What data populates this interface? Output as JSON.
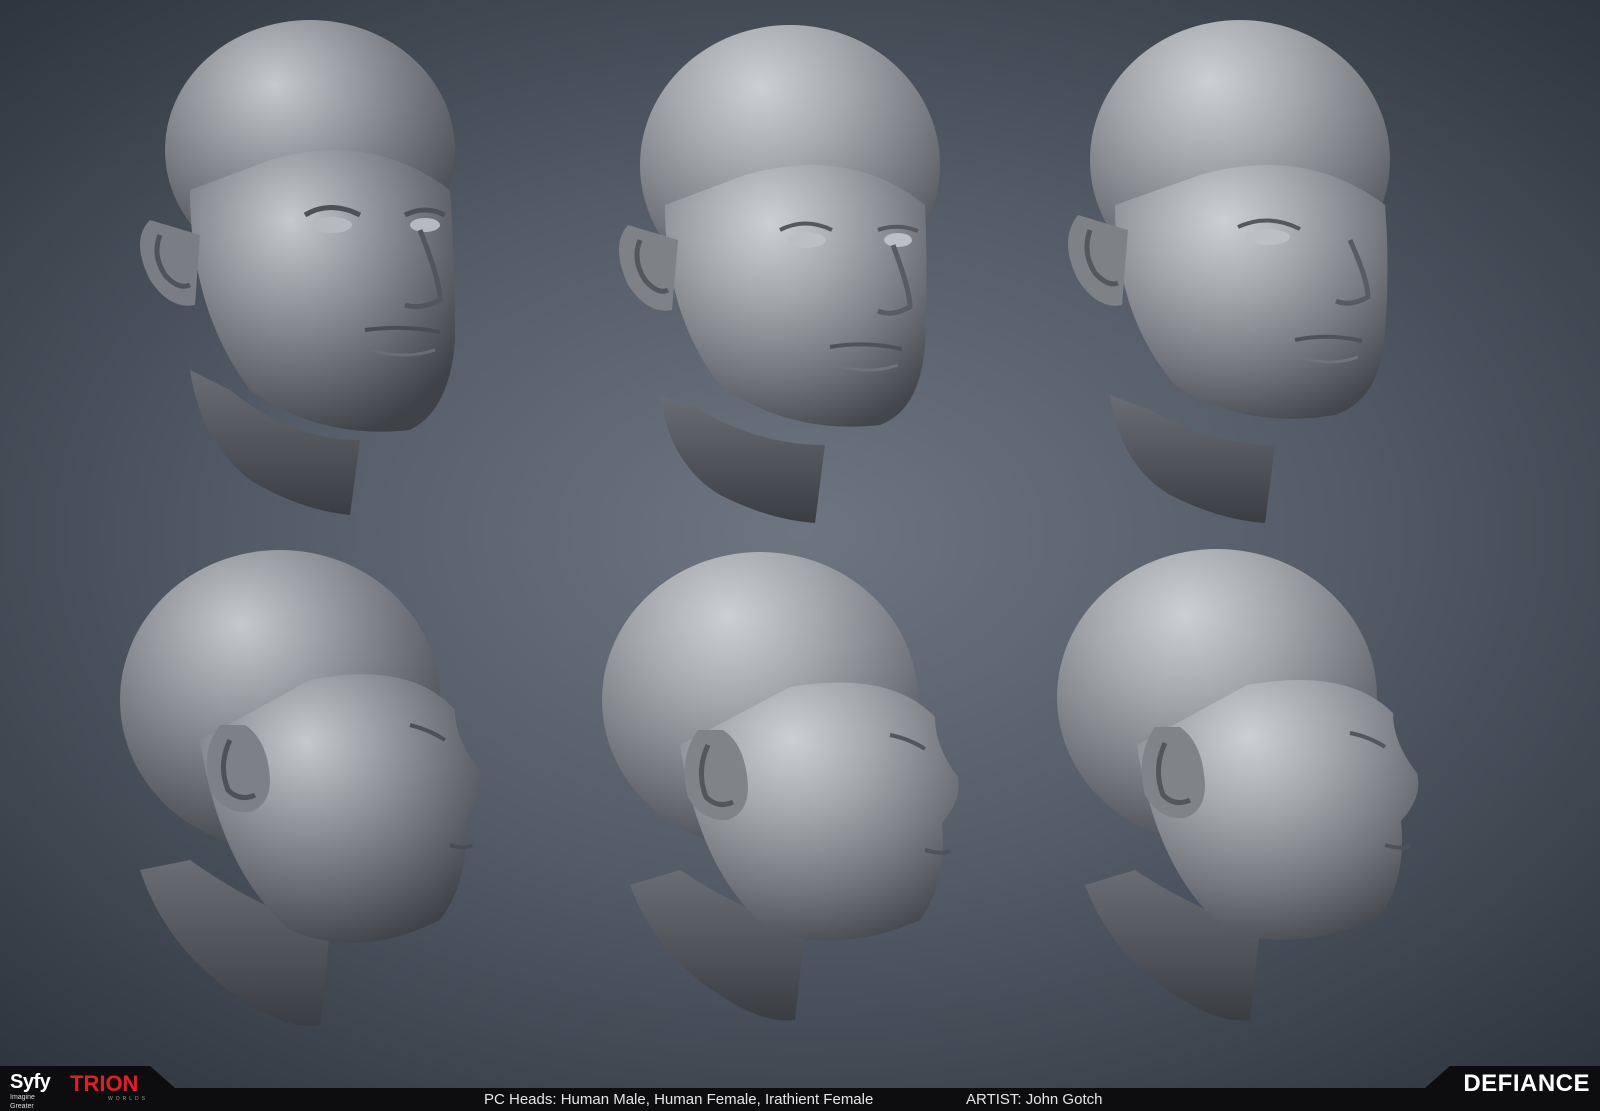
{
  "image": {
    "subject": "digital sculpt presentation of three bald head models",
    "background_color": "#5a636e",
    "sculpt_color": "#8c9096"
  },
  "views": {
    "top_row": "three-quarter front",
    "bottom_row": "side profile"
  },
  "heads": [
    {
      "model": "human-male",
      "view": "three-quarter"
    },
    {
      "model": "human-female",
      "view": "three-quarter"
    },
    {
      "model": "irathient-female",
      "view": "three-quarter"
    },
    {
      "model": "human-male",
      "view": "profile"
    },
    {
      "model": "human-female",
      "view": "profile"
    },
    {
      "model": "irathient-female",
      "view": "profile"
    }
  ],
  "footer": {
    "caption": "PC Heads: Human Male, Human Female, Irathient Female",
    "artist": "ARTIST: John Gotch",
    "bar_color": "#0d0d0f",
    "text_color": "#e6e6e6"
  },
  "logos": {
    "syfy": {
      "word": "Syfy",
      "tagline": "Imagine Greater",
      "color": "#ffffff"
    },
    "trion": {
      "word": "TRION",
      "sub": "WORLDS",
      "color": "#e01e26"
    },
    "defiance": {
      "word": "DEFIANCE",
      "color": "#ffffff"
    }
  }
}
